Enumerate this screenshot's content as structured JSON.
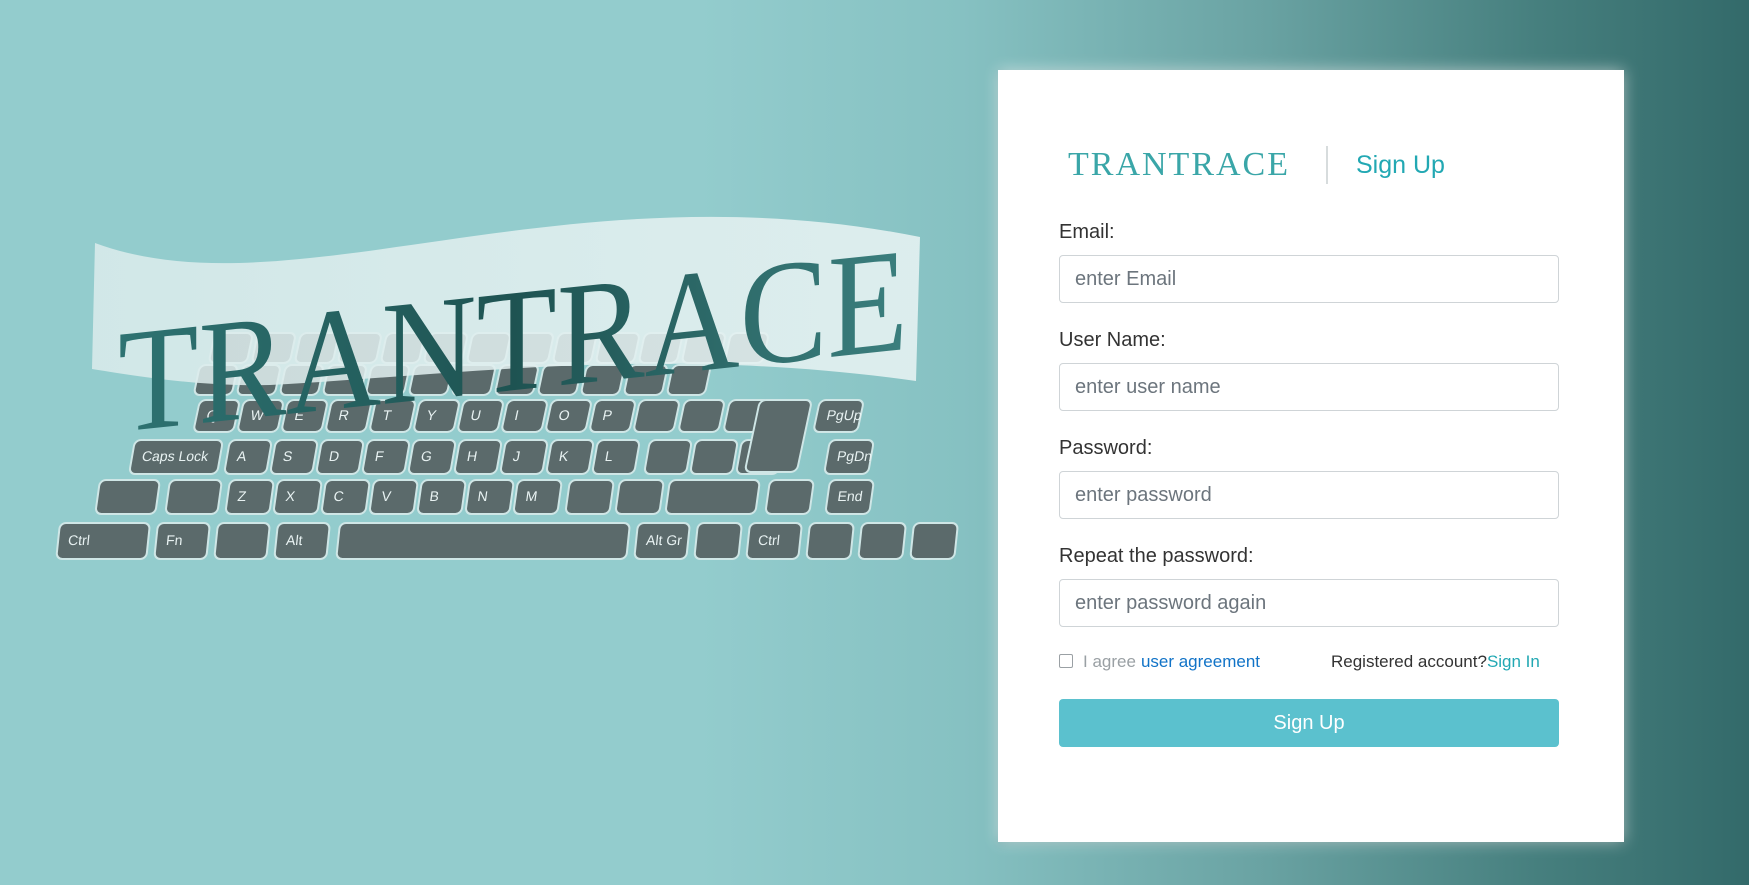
{
  "hero": {
    "logo_text": "TRANTRACE"
  },
  "card": {
    "brand": "TRANTRACE",
    "title": "Sign Up",
    "fields": [
      {
        "label": "Email:",
        "placeholder": "enter Email"
      },
      {
        "label": "User Name:",
        "placeholder": "enter user name"
      },
      {
        "label": "Password:",
        "placeholder": "enter password"
      },
      {
        "label": "Repeat the password:",
        "placeholder": "enter password again"
      }
    ],
    "agree_text": "I agree",
    "agree_link": "user agreement",
    "registered_text": "Registered account?",
    "signin_link": "Sign In",
    "submit_label": "Sign Up"
  },
  "keyboard": {
    "rows": [
      [
        "Q",
        "W",
        "E",
        "R",
        "T",
        "Y",
        "U",
        "I",
        "O",
        "P"
      ],
      [
        "A",
        "S",
        "D",
        "F",
        "G",
        "H",
        "J",
        "K",
        "L"
      ],
      [
        "Z",
        "X",
        "C",
        "V",
        "B",
        "N",
        "M"
      ]
    ],
    "special": [
      "Caps Lock",
      "Ctrl",
      "Fn",
      "Alt",
      "Alt Gr",
      "Ctrl",
      "End",
      "PgDn",
      "PgUp"
    ]
  },
  "colors": {
    "accent": "#22a8b3",
    "button": "#5bc1ce",
    "link": "#1173c7",
    "key": "#5b6a6b",
    "logo_dark": "#2b6867"
  }
}
